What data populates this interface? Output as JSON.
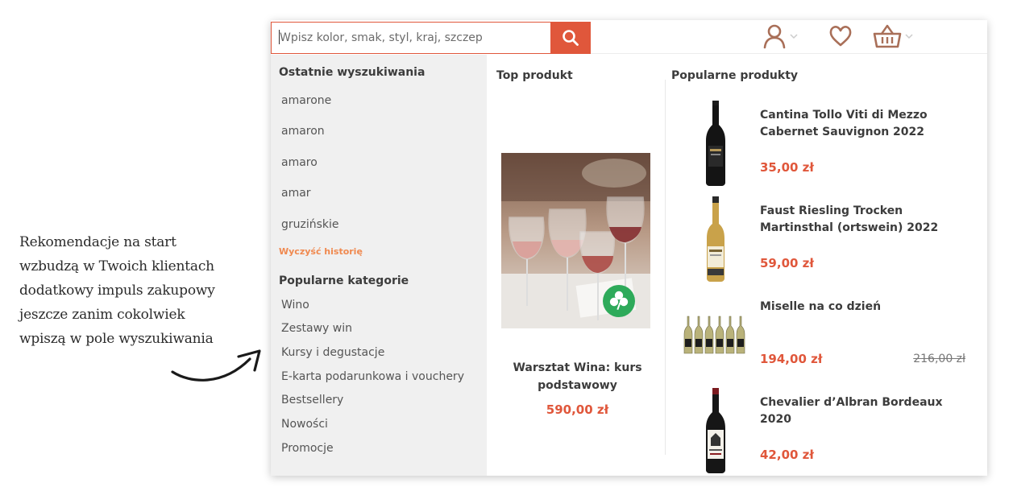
{
  "annotation": {
    "lines": [
      "Rekomendacje na start",
      "wzbudzą w Twoich klientach",
      "dodatkowy impuls zakupowy",
      "jeszcze zanim cokolwiek",
      "wpiszą w pole wyszukiwania"
    ]
  },
  "search": {
    "placeholder": "Wpisz kolor, smak, styl, kraj, szczep",
    "value": ""
  },
  "icons": {
    "search": "search-icon",
    "user": "user-icon",
    "wishlist": "heart-icon",
    "cart": "basket-icon",
    "chevron": "chevron-down-icon",
    "badge": "shamrock-icon"
  },
  "colors": {
    "accent": "#e0573b",
    "icon": "#a96f58",
    "clear_link": "#f0894f",
    "left_bg": "#f0f0f0",
    "badge": "#2eaa5a"
  },
  "recent": {
    "title": "Ostatnie wyszukiwania",
    "items": [
      "amarone",
      "amaron",
      "amaro",
      "amar",
      "gruzińskie"
    ],
    "clear_label": "Wyczyść historię"
  },
  "categories": {
    "title": "Popularne kategorie",
    "items": [
      "Wino",
      "Zestawy win",
      "Kursy i degustacje",
      "E-karta podarunkowa i vouchery",
      "Bestsellery",
      "Nowości",
      "Promocje"
    ]
  },
  "top_product": {
    "title": "Top produkt",
    "name": "Warsztat Wina: kurs podstawowy",
    "price": "590,00 zł"
  },
  "popular": {
    "title": "Popularne produkty",
    "items": [
      {
        "name": "Cantina Tollo Viti di Mezzo Cabernet Sauvignon 2022",
        "price": "35,00 zł",
        "old_price": ""
      },
      {
        "name": "Faust Riesling Trocken Martinsthal (ortswein) 2022",
        "price": "59,00 zł",
        "old_price": ""
      },
      {
        "name": "Miselle na co dzień",
        "price": "194,00 zł",
        "old_price": "216,00 zł"
      },
      {
        "name": "Chevalier d’Albran Bordeaux 2020",
        "price": "42,00 zł",
        "old_price": ""
      }
    ]
  }
}
